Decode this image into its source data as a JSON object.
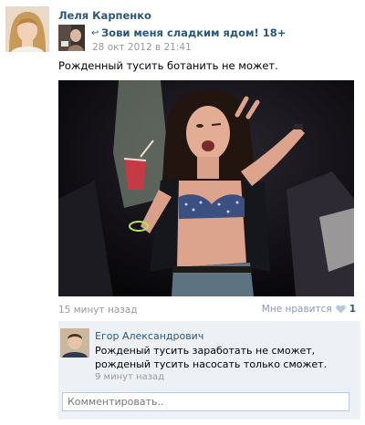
{
  "post": {
    "author_name": "Леля Карпенко",
    "repost": {
      "group_name": "Зови меня сладким ядом! 18+",
      "date": "28 окт 2012 в 21:41"
    },
    "text": "Рожденный тусить ботанить не может.",
    "time_ago": "15 минут назад",
    "like_label": "Мне нравится",
    "like_count": "1"
  },
  "comments": [
    {
      "author": "Егор Александрович",
      "text": "Рожденый тусить заработать не сможет, рожденый тусить насосать только сможет.",
      "time": "9 минут назад"
    }
  ],
  "comment_input": {
    "placeholder": "Комментировать.."
  },
  "colors": {
    "link": "#2b587a",
    "muted": "#999999",
    "comment_bg": "#edf1f5"
  }
}
